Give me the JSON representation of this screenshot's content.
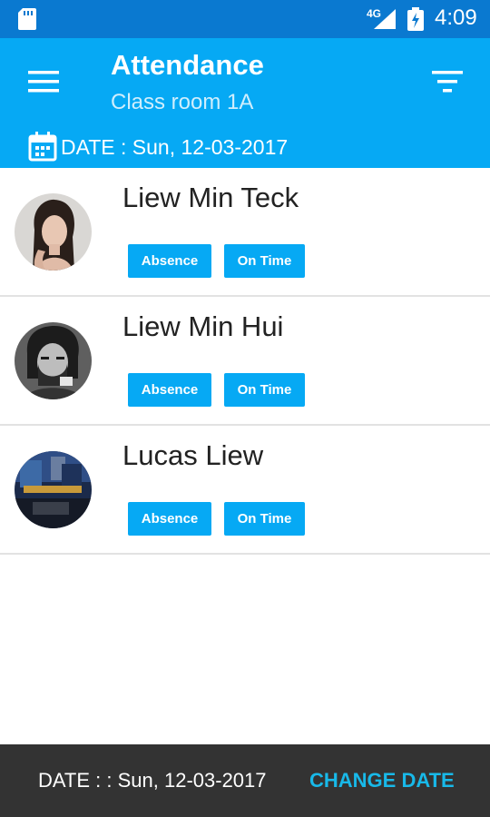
{
  "status_bar": {
    "network": "4G",
    "time": "4:09",
    "icons": [
      "sd-card-icon",
      "signal-icon",
      "battery-icon"
    ]
  },
  "app_bar": {
    "title": "Attendance",
    "subtitle": "Class room 1A",
    "date_label": "DATE : Sun, 12-03-2017",
    "icons": [
      "menu-icon",
      "filter-icon",
      "calendar-icon"
    ]
  },
  "students": [
    {
      "name": "Liew Min Teck",
      "absence_label": "Absence",
      "ontime_label": "On Time"
    },
    {
      "name": "Liew Min Hui",
      "absence_label": "Absence",
      "ontime_label": "On Time"
    },
    {
      "name": "Lucas Liew",
      "absence_label": "Absence",
      "ontime_label": "On Time"
    }
  ],
  "bottom_bar": {
    "date_text": "DATE : : Sun, 12-03-2017",
    "action_label": "CHANGE DATE"
  },
  "colors": {
    "status_bar": "#0a79d0",
    "app_bar": "#06a9f4",
    "button": "#06a9f4",
    "bottom_bar": "#333333",
    "action_text": "#18b9e9"
  }
}
